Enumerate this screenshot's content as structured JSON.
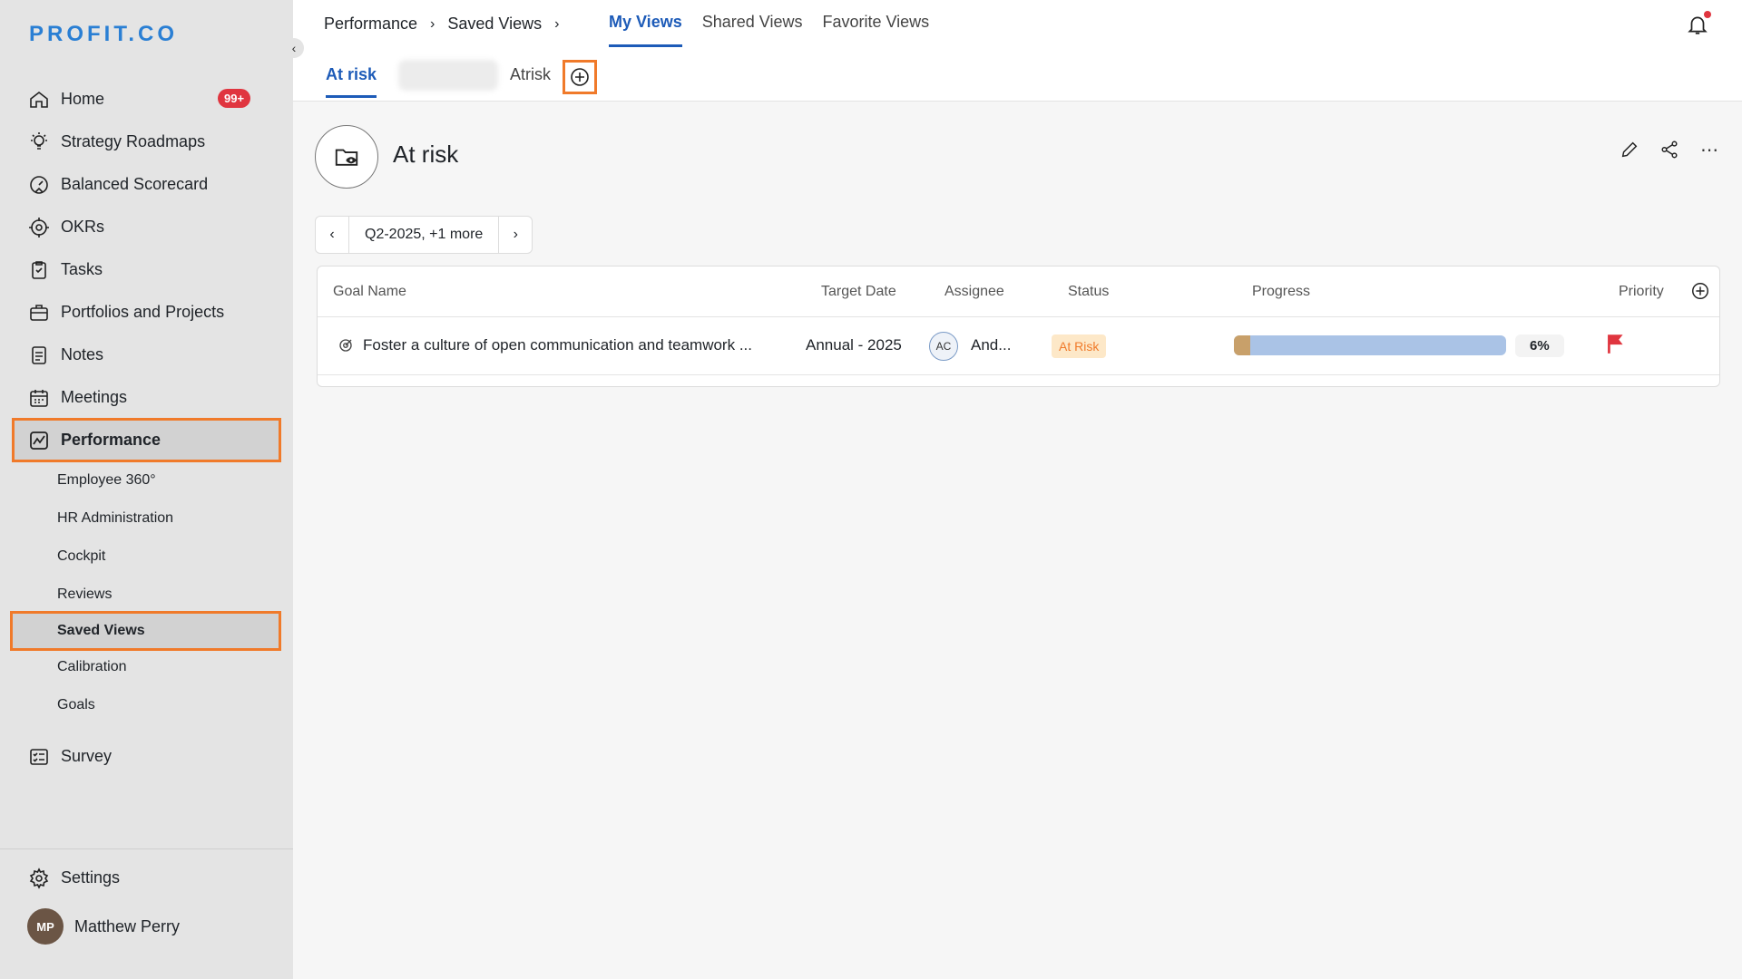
{
  "app": {
    "logo": "PROFIT.CO"
  },
  "sidebar": {
    "items": [
      {
        "label": "Home",
        "icon": "home-icon",
        "badge": "99+"
      },
      {
        "label": "Strategy Roadmaps",
        "icon": "bulb-icon"
      },
      {
        "label": "Balanced Scorecard",
        "icon": "scorecard-icon"
      },
      {
        "label": "OKRs",
        "icon": "target-icon"
      },
      {
        "label": "Tasks",
        "icon": "clipboard-check-icon"
      },
      {
        "label": "Portfolios and Projects",
        "icon": "briefcase-icon"
      },
      {
        "label": "Notes",
        "icon": "notes-icon"
      },
      {
        "label": "Meetings",
        "icon": "calendar-icon"
      },
      {
        "label": "Performance",
        "icon": "performance-chart-icon"
      }
    ],
    "sub_items": [
      "Employee 360°",
      "HR Administration",
      "Cockpit",
      "Reviews",
      "Saved Views",
      "Calibration",
      "Goals"
    ],
    "survey": "Survey",
    "settings": "Settings",
    "user": {
      "name": "Matthew Perry"
    }
  },
  "breadcrumb": {
    "first": "Performance",
    "second": "Saved Views"
  },
  "view_tabs": [
    "My Views",
    "Shared Views",
    "Favorite Views"
  ],
  "saved_tabs": [
    "At risk",
    "Atrisk"
  ],
  "view": {
    "title": "At risk",
    "period": "Q2-2025, +1 more"
  },
  "table": {
    "headers": [
      "Goal Name",
      "Target Date",
      "Assignee",
      "Status",
      "Progress",
      "Priority"
    ],
    "rows": [
      {
        "goal": "Foster a culture of open communication and teamwork ...",
        "target_date": "Annual - 2025",
        "assignee_initials": "AC",
        "assignee": "And...",
        "status": "At Risk",
        "progress": 6,
        "progress_label": "6%"
      }
    ]
  },
  "colors": {
    "accent": "#1d5bb8",
    "highlight": "#f07a2a",
    "danger": "#e0353f"
  }
}
